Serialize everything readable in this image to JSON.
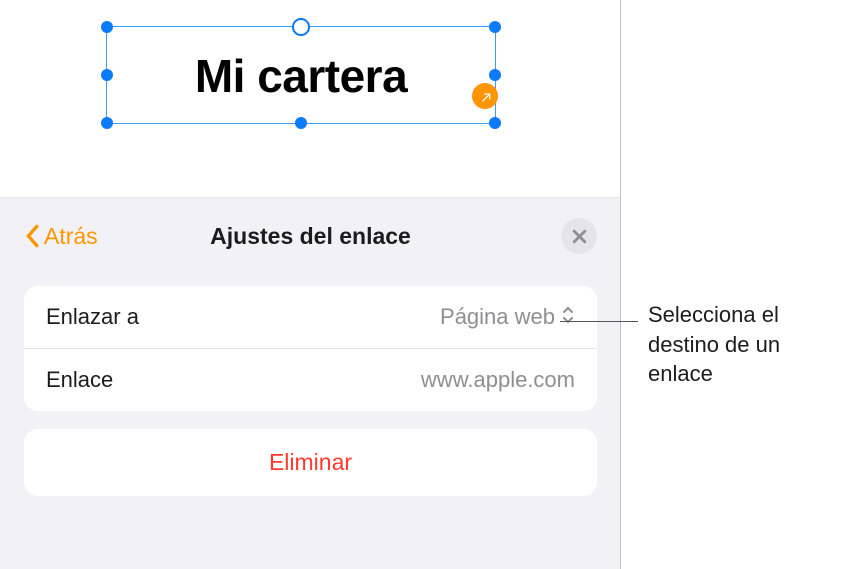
{
  "canvas": {
    "text": "Mi cartera"
  },
  "panel": {
    "back_label": "Atrás",
    "title": "Ajustes del enlace",
    "rows": {
      "link_to": {
        "label": "Enlazar a",
        "value": "Página web"
      },
      "link": {
        "label": "Enlace",
        "placeholder": "www.apple.com"
      }
    },
    "delete_label": "Eliminar"
  },
  "callout": {
    "text": "Selecciona el destino de un enlace"
  }
}
